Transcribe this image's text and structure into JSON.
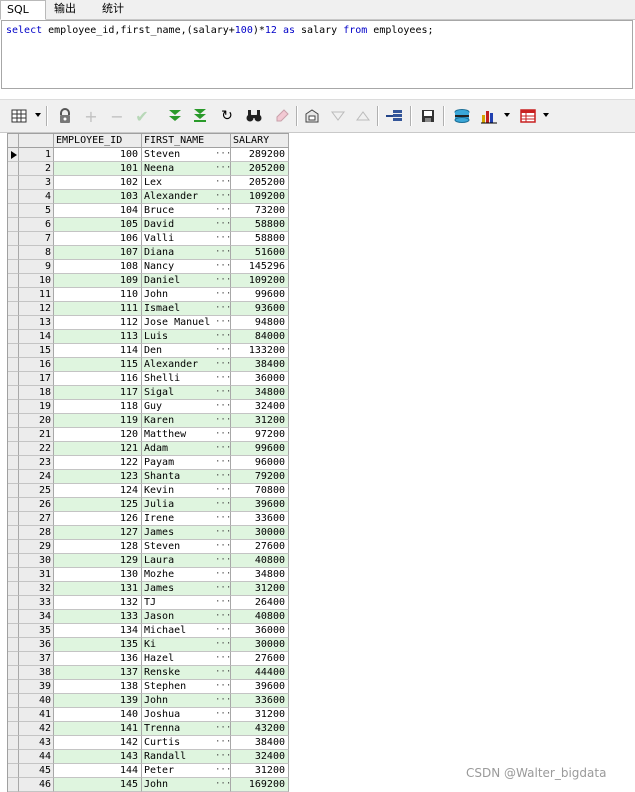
{
  "tabs": [
    {
      "label": "SQL",
      "active": true
    },
    {
      "label": "输出",
      "active": false
    },
    {
      "label": "统计",
      "active": false
    }
  ],
  "editor": {
    "tokens": [
      {
        "text": "select",
        "type": "kw"
      },
      {
        "text": " employee_id,first_name,(salary+",
        "type": "plain"
      },
      {
        "text": "100",
        "type": "num"
      },
      {
        "text": ")*",
        "type": "plain"
      },
      {
        "text": "12",
        "type": "num"
      },
      {
        "text": " ",
        "type": "plain"
      },
      {
        "text": "as",
        "type": "kw"
      },
      {
        "text": " salary ",
        "type": "plain"
      },
      {
        "text": "from",
        "type": "kw"
      },
      {
        "text": " employees;",
        "type": "plain"
      }
    ]
  },
  "toolbar": {
    "icons": [
      "grid-view-icon",
      "lock-icon",
      "add-row-icon",
      "delete-row-icon",
      "post-changes-icon",
      "fetch-next-icon",
      "fetch-last-icon",
      "refresh-icon",
      "find-icon",
      "clear-icon",
      "query-by-example-icon",
      "sort-desc-icon",
      "sort-asc-icon",
      "single-record-icon",
      "save-icon",
      "export-icon",
      "chart-icon",
      "table-export-icon"
    ]
  },
  "grid": {
    "columns": [
      "EMPLOYEE_ID",
      "FIRST_NAME",
      "SALARY"
    ],
    "rows": [
      {
        "no": "1",
        "id": "100",
        "name": "Steven",
        "salary": "289200"
      },
      {
        "no": "2",
        "id": "101",
        "name": "Neena",
        "salary": "205200"
      },
      {
        "no": "3",
        "id": "102",
        "name": "Lex",
        "salary": "205200"
      },
      {
        "no": "4",
        "id": "103",
        "name": "Alexander",
        "salary": "109200"
      },
      {
        "no": "5",
        "id": "104",
        "name": "Bruce",
        "salary": "73200"
      },
      {
        "no": "6",
        "id": "105",
        "name": "David",
        "salary": "58800"
      },
      {
        "no": "7",
        "id": "106",
        "name": "Valli",
        "salary": "58800"
      },
      {
        "no": "8",
        "id": "107",
        "name": "Diana",
        "salary": "51600"
      },
      {
        "no": "9",
        "id": "108",
        "name": "Nancy",
        "salary": "145296"
      },
      {
        "no": "10",
        "id": "109",
        "name": "Daniel",
        "salary": "109200"
      },
      {
        "no": "11",
        "id": "110",
        "name": "John",
        "salary": "99600"
      },
      {
        "no": "12",
        "id": "111",
        "name": "Ismael",
        "salary": "93600"
      },
      {
        "no": "13",
        "id": "112",
        "name": "Jose Manuel",
        "salary": "94800"
      },
      {
        "no": "14",
        "id": "113",
        "name": "Luis",
        "salary": "84000"
      },
      {
        "no": "15",
        "id": "114",
        "name": "Den",
        "salary": "133200"
      },
      {
        "no": "16",
        "id": "115",
        "name": "Alexander",
        "salary": "38400"
      },
      {
        "no": "17",
        "id": "116",
        "name": "Shelli",
        "salary": "36000"
      },
      {
        "no": "18",
        "id": "117",
        "name": "Sigal",
        "salary": "34800"
      },
      {
        "no": "19",
        "id": "118",
        "name": "Guy",
        "salary": "32400"
      },
      {
        "no": "20",
        "id": "119",
        "name": "Karen",
        "salary": "31200"
      },
      {
        "no": "21",
        "id": "120",
        "name": "Matthew",
        "salary": "97200"
      },
      {
        "no": "22",
        "id": "121",
        "name": "Adam",
        "salary": "99600"
      },
      {
        "no": "23",
        "id": "122",
        "name": "Payam",
        "salary": "96000"
      },
      {
        "no": "24",
        "id": "123",
        "name": "Shanta",
        "salary": "79200"
      },
      {
        "no": "25",
        "id": "124",
        "name": "Kevin",
        "salary": "70800"
      },
      {
        "no": "26",
        "id": "125",
        "name": "Julia",
        "salary": "39600"
      },
      {
        "no": "27",
        "id": "126",
        "name": "Irene",
        "salary": "33600"
      },
      {
        "no": "28",
        "id": "127",
        "name": "James",
        "salary": "30000"
      },
      {
        "no": "29",
        "id": "128",
        "name": "Steven",
        "salary": "27600"
      },
      {
        "no": "30",
        "id": "129",
        "name": "Laura",
        "salary": "40800"
      },
      {
        "no": "31",
        "id": "130",
        "name": "Mozhe",
        "salary": "34800"
      },
      {
        "no": "32",
        "id": "131",
        "name": "James",
        "salary": "31200"
      },
      {
        "no": "33",
        "id": "132",
        "name": "TJ",
        "salary": "26400"
      },
      {
        "no": "34",
        "id": "133",
        "name": "Jason",
        "salary": "40800"
      },
      {
        "no": "35",
        "id": "134",
        "name": "Michael",
        "salary": "36000"
      },
      {
        "no": "36",
        "id": "135",
        "name": "Ki",
        "salary": "30000"
      },
      {
        "no": "37",
        "id": "136",
        "name": "Hazel",
        "salary": "27600"
      },
      {
        "no": "38",
        "id": "137",
        "name": "Renske",
        "salary": "44400"
      },
      {
        "no": "39",
        "id": "138",
        "name": "Stephen",
        "salary": "39600"
      },
      {
        "no": "40",
        "id": "139",
        "name": "John",
        "salary": "33600"
      },
      {
        "no": "41",
        "id": "140",
        "name": "Joshua",
        "salary": "31200"
      },
      {
        "no": "42",
        "id": "141",
        "name": "Trenna",
        "salary": "43200"
      },
      {
        "no": "43",
        "id": "142",
        "name": "Curtis",
        "salary": "38400"
      },
      {
        "no": "44",
        "id": "143",
        "name": "Randall",
        "salary": "32400"
      },
      {
        "no": "45",
        "id": "144",
        "name": "Peter",
        "salary": "31200"
      },
      {
        "no": "46",
        "id": "145",
        "name": "John",
        "salary": "169200"
      }
    ],
    "dots": "···",
    "alt_color": "#dff5df"
  },
  "watermark": "CSDN @Walter_bigdata"
}
